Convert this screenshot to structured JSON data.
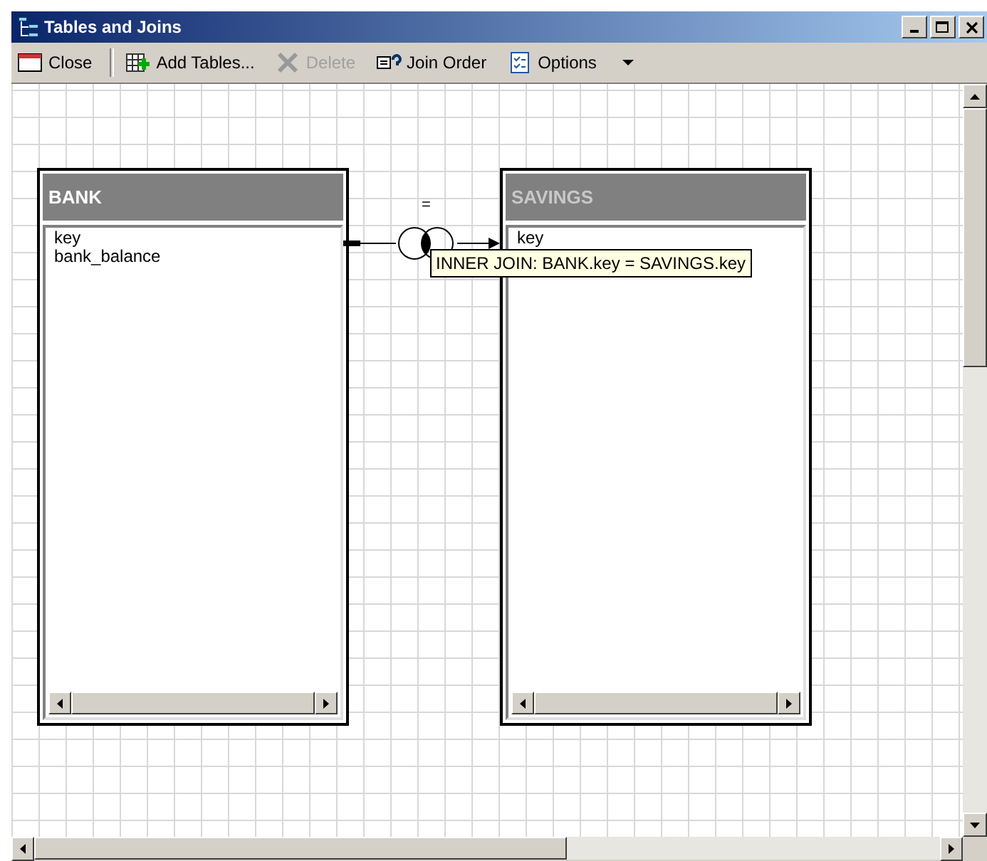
{
  "window": {
    "title": "Tables and Joins"
  },
  "toolbar": [
    {
      "kind": "close",
      "label": "Close",
      "disabled": false
    },
    {
      "kind": "separator"
    },
    {
      "kind": "add",
      "label": "Add Tables...",
      "disabled": false
    },
    {
      "kind": "delete",
      "label": "Delete",
      "disabled": true
    },
    {
      "kind": "order",
      "label": "Join Order",
      "disabled": false
    },
    {
      "kind": "options",
      "label": "Options",
      "disabled": false
    },
    {
      "kind": "dropdown"
    }
  ],
  "tables": [
    {
      "name": "BANK",
      "selected": true,
      "fields": [
        "key",
        "bank_balance"
      ]
    },
    {
      "name": "SAVINGS",
      "selected": false,
      "fields": [
        "key"
      ]
    }
  ],
  "join": {
    "operator": "=",
    "tooltip": "INNER JOIN: BANK.key = SAVINGS.key"
  }
}
